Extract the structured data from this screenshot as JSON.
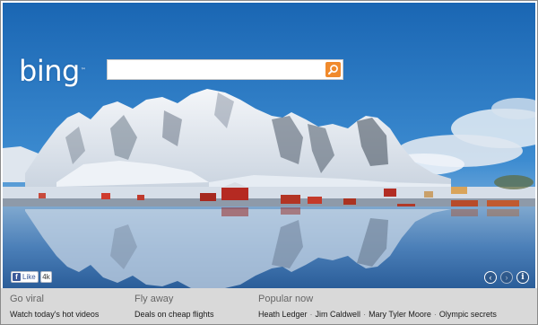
{
  "logo": {
    "text": "bing",
    "tm": "™"
  },
  "search": {
    "value": "",
    "placeholder": ""
  },
  "facebook": {
    "like_label": "Like",
    "count": "4k"
  },
  "nav": {
    "prev": "‹",
    "next": "›",
    "info": "i"
  },
  "footer": {
    "columns": [
      {
        "heading": "Go viral",
        "links": [
          "Watch today's hot videos"
        ]
      },
      {
        "heading": "Fly away",
        "links": [
          "Deals on cheap flights"
        ]
      },
      {
        "heading": "Popular now",
        "links": [
          "Heath Ledger",
          "Jim Caldwell",
          "Mary Tyler Moore",
          "Olympic secrets"
        ]
      }
    ],
    "separator": "·"
  },
  "colors": {
    "sky": "#2d7cc2",
    "search_button": "#f08a2c",
    "footer_bg": "#d9d9d9",
    "facebook": "#3b5998"
  },
  "icons": {
    "search": "magnifier-icon",
    "facebook": "facebook-f-icon",
    "prev": "chevron-left-icon",
    "next": "chevron-right-icon",
    "info": "info-icon"
  }
}
